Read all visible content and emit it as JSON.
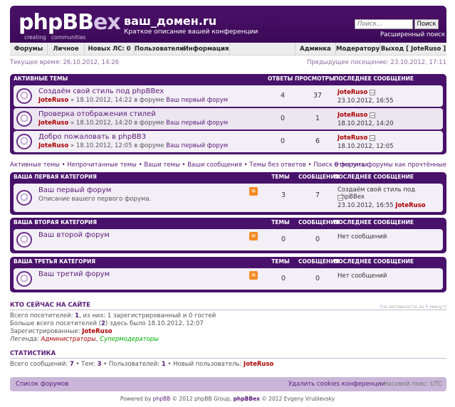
{
  "header": {
    "logo_main": "phpBB",
    "logo_suffix": "ex",
    "logo_tag_1": "creating",
    "logo_tag_2": "communities",
    "site_title": "ваш_домен.ru",
    "site_desc": "Краткое описание вашей конференции",
    "search_placeholder": "Поиск...",
    "search_button": "Поиск",
    "advanced_search": "Расширенный поиск"
  },
  "navbar": {
    "items": [
      "Форумы",
      "Личное",
      "Новых ЛС: 0",
      "Пользователи",
      "Информация",
      "Админка",
      "Модератору",
      "Выход [ JoteRuso ]"
    ]
  },
  "time": {
    "current": "Текущее время: 26.10.2012, 14:26",
    "last_visit": "Предыдущее посещение: 23.10.2012, 17:11"
  },
  "active_topics": {
    "header": "Активные темы",
    "col_replies": "Ответы",
    "col_views": "Просмотры",
    "col_last": "Последнее сообщение",
    "rows": [
      {
        "title": "Создаём свой стиль под phpBBex",
        "author": "JoteRuso",
        "meta": " » 18.10.2012, 14:22 в форуме ",
        "forum": "Ваш первый форум",
        "replies": "4",
        "views": "37",
        "last_user": "JoteRuso",
        "last_date": "23.10.2012, 16:55"
      },
      {
        "title": "Проверка отображения стилей",
        "author": "JoteRuso",
        "meta": " » 18.10.2012, 14:20 в форуме ",
        "forum": "Ваш первый форум",
        "replies": "0",
        "views": "1",
        "last_user": "JoteRuso",
        "last_date": "18.10.2012, 14:20"
      },
      {
        "title": "Добро пожаловать в phpBB3",
        "author": "JoteRuso",
        "meta": " » 18.10.2012, 12:05 в форуме ",
        "forum": "Ваш первый форум",
        "replies": "0",
        "views": "6",
        "last_user": "JoteRuso",
        "last_date": "18.10.2012, 12:05"
      }
    ]
  },
  "quicklinks": {
    "left": "Активные темы • Непрочитанные темы • Ваши темы • Ваши сообщения • Темы без ответов • Поиск в форумах",
    "right": "Отметить форумы как прочтённые"
  },
  "categories": [
    {
      "header": "Ваша первая категория",
      "col_topics": "Темы",
      "col_posts": "Сообщения",
      "col_last": "Последнее сообщение",
      "forum": "Ваш первый форум",
      "desc": "Описание вашего первого форума.",
      "topics": "3",
      "posts": "7",
      "last_title": "Создаём свой стиль под phpBBex",
      "last_date": "23.10.2012, 16:55 ",
      "last_user": "JoteRuso"
    },
    {
      "header": "Ваша вторая категория",
      "col_topics": "Темы",
      "col_posts": "Сообщения",
      "col_last": "Последнее сообщение",
      "forum": "Ваш второй форум",
      "desc": "",
      "topics": "0",
      "posts": "0",
      "last_none": "Нет сообщений"
    },
    {
      "header": "Ваша третья категория",
      "col_topics": "Темы",
      "col_posts": "Сообщения",
      "col_last": "Последнее сообщение",
      "forum": "Ваш третий форум",
      "desc": "",
      "topics": "0",
      "posts": "0",
      "last_none": "Нет сообщений"
    }
  ],
  "online": {
    "title": "Кто сейчас на сайте",
    "note": "(по активности за 5 минут)",
    "total_a": "Всего посетителей: ",
    "total_n": "1",
    "total_b": ", из них: 1 зарегистрированный и 0 гостей",
    "max_a": "Больше всего посетителей (",
    "max_n": "2",
    "max_b": ") здесь было 18.10.2012, 12:07",
    "registered_label": "Зарегистрированные: ",
    "registered_user": "JoteRuso",
    "legend_label": "Легенда: ",
    "legend_admins": "Администраторы",
    "legend_sep": ", ",
    "legend_mods": "Супермодераторы"
  },
  "stats": {
    "title": "Статистика",
    "posts_label": "Всего сообщений: ",
    "posts": "7",
    "topics_label": " • Тем: ",
    "topics": "3",
    "users_label": " • Пользователей: ",
    "users": "1",
    "newest_label": " • Новый пользователь: ",
    "newest": "JoteRuso"
  },
  "footer": {
    "forum_index": "Список форумов",
    "delete_cookies": "Удалить cookies конференции",
    "timezone": " • Часовой пояс: UTC",
    "copyright_a": "Powered by ",
    "copyright_b": "phpBB",
    "copyright_c": " © 2012 phpBB Group, ",
    "copyright_d": "phpBBex",
    "copyright_e": " © 2012 Evgeny Vrublevsky"
  }
}
